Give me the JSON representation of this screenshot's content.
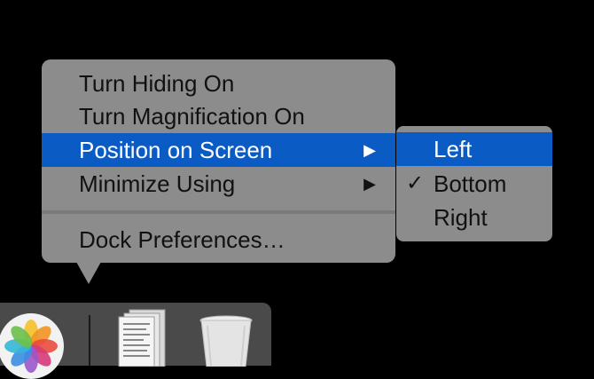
{
  "dock_menu": {
    "items": [
      {
        "label": "Turn Hiding On"
      },
      {
        "label": "Turn Magnification On"
      },
      {
        "label": "Position on Screen",
        "arrow": "▶"
      },
      {
        "label": "Minimize Using",
        "arrow": "▶"
      },
      {
        "label": "Dock Preferences…"
      }
    ]
  },
  "position_submenu": {
    "items": [
      {
        "label": "Left"
      },
      {
        "label": "Bottom",
        "check": "✓"
      },
      {
        "label": "Right"
      }
    ]
  },
  "dock": {
    "icons": [
      "photos-icon",
      "documents-stack-icon",
      "trash-icon"
    ]
  },
  "colors": {
    "menu_bg": "#8c8c8c",
    "highlight": "#0a5bc4",
    "dock_bg": "#4a4a4a"
  }
}
